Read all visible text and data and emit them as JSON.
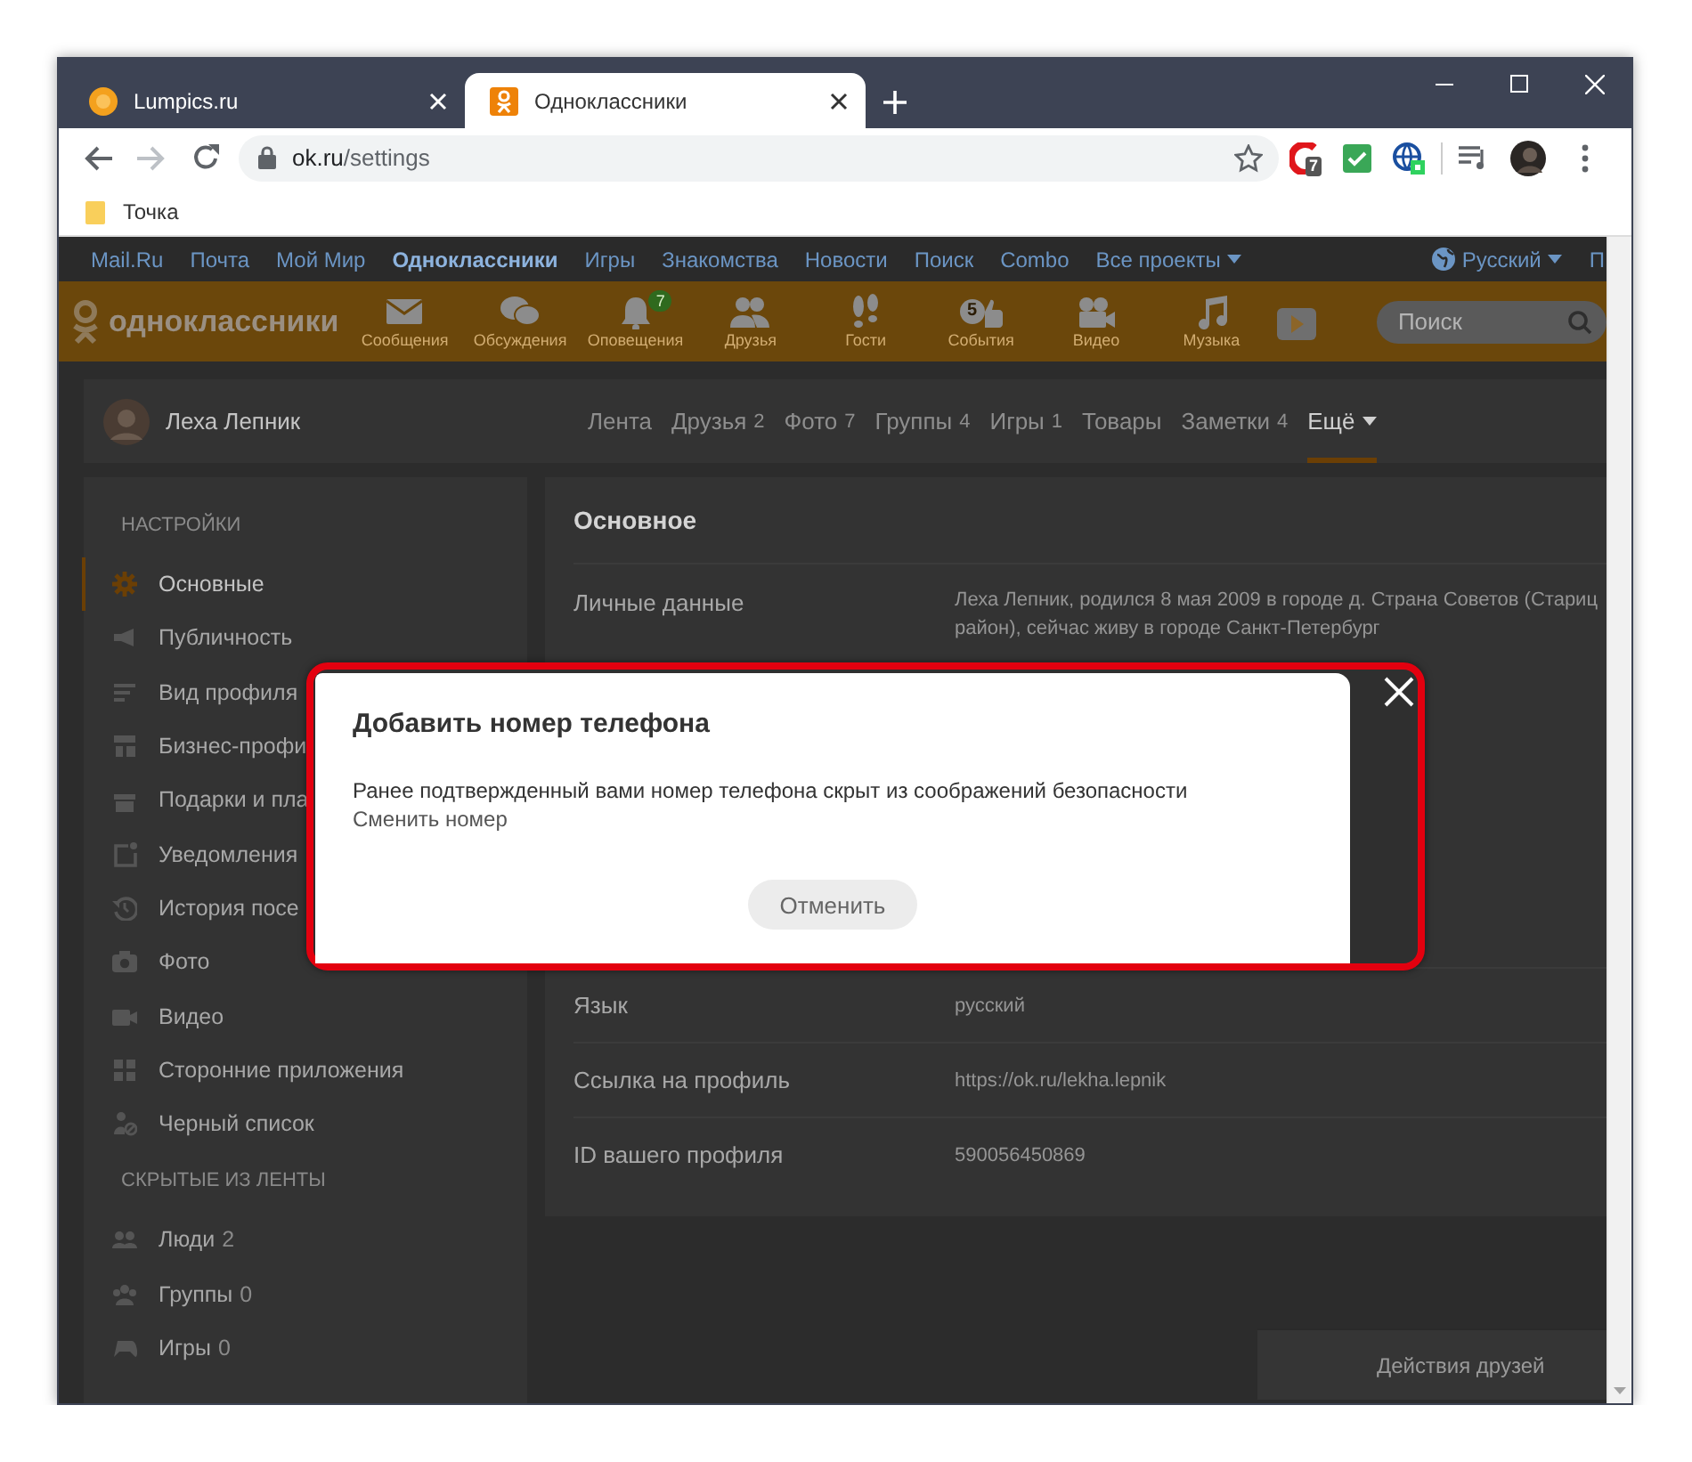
{
  "browser": {
    "tabs": [
      {
        "title": "Lumpics.ru",
        "kind": "circle",
        "selected": false
      },
      {
        "title": "Одноклассники",
        "kind": "square",
        "selected": true
      }
    ],
    "address": {
      "host": "ok.ru",
      "path": "/settings"
    },
    "extensions": [
      {
        "kind": "shield",
        "badge": "7"
      },
      {
        "kind": "check"
      },
      {
        "kind": "globe"
      }
    ],
    "bookmarks": [
      {
        "label": "Точка"
      }
    ]
  },
  "portal_bar": {
    "links": [
      {
        "label": "Mail.Ru",
        "selected": false
      },
      {
        "label": "Почта",
        "selected": false
      },
      {
        "label": "Мой Мир",
        "selected": false
      },
      {
        "label": "Одноклассники",
        "selected": true
      },
      {
        "label": "Игры",
        "selected": false
      },
      {
        "label": "Знакомства",
        "selected": false
      },
      {
        "label": "Новости",
        "selected": false
      },
      {
        "label": "Поиск",
        "selected": false
      },
      {
        "label": "Combo",
        "selected": false
      },
      {
        "label": "Все проекты",
        "selected": false,
        "dropdown": true
      }
    ],
    "language": "Русский",
    "cut_link": "П"
  },
  "header": {
    "logo": "одноклассники",
    "nav": [
      {
        "kind": "envelope",
        "label": "Сообщения"
      },
      {
        "kind": "chat",
        "label": "Обсуждения"
      },
      {
        "kind": "bell",
        "label": "Оповещения",
        "badge": "7"
      },
      {
        "kind": "friends",
        "label": "Друзья"
      },
      {
        "kind": "footprints",
        "label": "Гости"
      },
      {
        "kind": "events",
        "label": "События",
        "badge": "5"
      },
      {
        "kind": "camera",
        "label": "Видео"
      },
      {
        "kind": "music",
        "label": "Музыка"
      },
      {
        "kind": "play"
      }
    ],
    "search": {
      "placeholder": "Поиск"
    }
  },
  "profile": {
    "name": "Леха Лепник",
    "tabs": [
      {
        "label": "Лента",
        "selected": false
      },
      {
        "label": "Друзья",
        "count": "2",
        "selected": false
      },
      {
        "label": "Фото",
        "count": "7",
        "selected": false
      },
      {
        "label": "Группы",
        "count": "4",
        "selected": false
      },
      {
        "label": "Игры",
        "count": "1",
        "selected": false
      },
      {
        "label": "Товары",
        "selected": false
      },
      {
        "label": "Заметки",
        "count": "4",
        "selected": false
      },
      {
        "label": "Ещё",
        "selected": true,
        "dropdown": true
      }
    ]
  },
  "sidebar": {
    "sections": [
      {
        "title": "НАСТРОЙКИ",
        "items": [
          {
            "kind": "gear",
            "label": "Основные",
            "selected": true
          },
          {
            "kind": "megaphone",
            "label": "Публичность",
            "selected": false
          },
          {
            "kind": "lines",
            "label": "Вид профиля",
            "selected": false
          },
          {
            "kind": "store",
            "label": "Бизнес-профи",
            "selected": false
          },
          {
            "kind": "gift",
            "label": "Подарки и пла",
            "selected": false
          },
          {
            "kind": "notification",
            "label": "Уведомления",
            "selected": false
          },
          {
            "kind": "history",
            "label": "История посе",
            "selected": false
          },
          {
            "kind": "photo",
            "label": "Фото",
            "selected": false
          },
          {
            "kind": "video",
            "label": "Видео",
            "selected": false
          },
          {
            "kind": "grid",
            "label": "Сторонние приложения",
            "selected": false
          },
          {
            "kind": "blocked",
            "label": "Черный список",
            "selected": false
          }
        ]
      },
      {
        "title": "СКРЫТЫЕ ИЗ ЛЕНТЫ",
        "items": [
          {
            "kind": "people",
            "label": "Люди",
            "count": "2",
            "selected": false
          },
          {
            "kind": "group",
            "label": "Группы",
            "count": "0",
            "selected": false
          },
          {
            "kind": "gamepad",
            "label": "Игры",
            "count": "0",
            "selected": false
          }
        ]
      }
    ]
  },
  "settings": {
    "title": "Основное",
    "rows": [
      {
        "label": "Личные данные",
        "value_lines": [
          "Леха Лепник, родился 8 мая 2009 в городе д. Страна Советов (Стариц",
          "район), сейчас живу в городе Санкт-Петербург"
        ]
      },
      {
        "label": "Язык",
        "value_lines": [
          "русский"
        ]
      },
      {
        "label": "Ссылка на профиль",
        "value_lines": [
          "https://ok.ru/lekha.lepnik"
        ]
      },
      {
        "label": "ID вашего профиля",
        "value_lines": [
          "590056450869"
        ]
      }
    ]
  },
  "friends_panel": {
    "title": "Действия друзей"
  },
  "dialog": {
    "title": "Добавить номер телефона",
    "message": "Ранее подтвержденный вами номер телефона скрыт из соображений безопасности",
    "link": "Сменить номер",
    "cancel": "Отменить",
    "highlighted": true
  }
}
